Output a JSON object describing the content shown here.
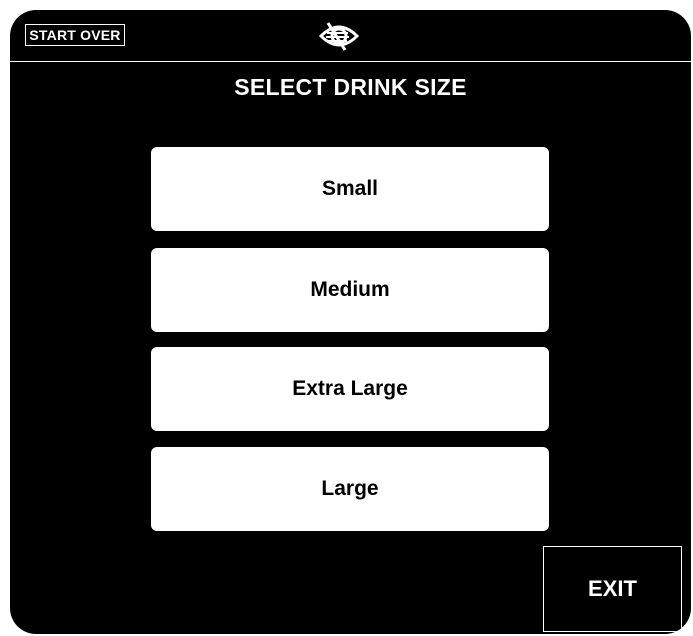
{
  "header": {
    "start_over_label": "START OVER",
    "logo_icon": "eye-slash-icon"
  },
  "main": {
    "title": "SELECT DRINK SIZE",
    "options": [
      {
        "label": "Small"
      },
      {
        "label": "Medium"
      },
      {
        "label": "Extra Large"
      },
      {
        "label": "Large"
      }
    ]
  },
  "footer": {
    "exit_label": "EXIT"
  },
  "colors": {
    "background": "#000000",
    "foreground": "#ffffff",
    "button_text": "#000000"
  }
}
